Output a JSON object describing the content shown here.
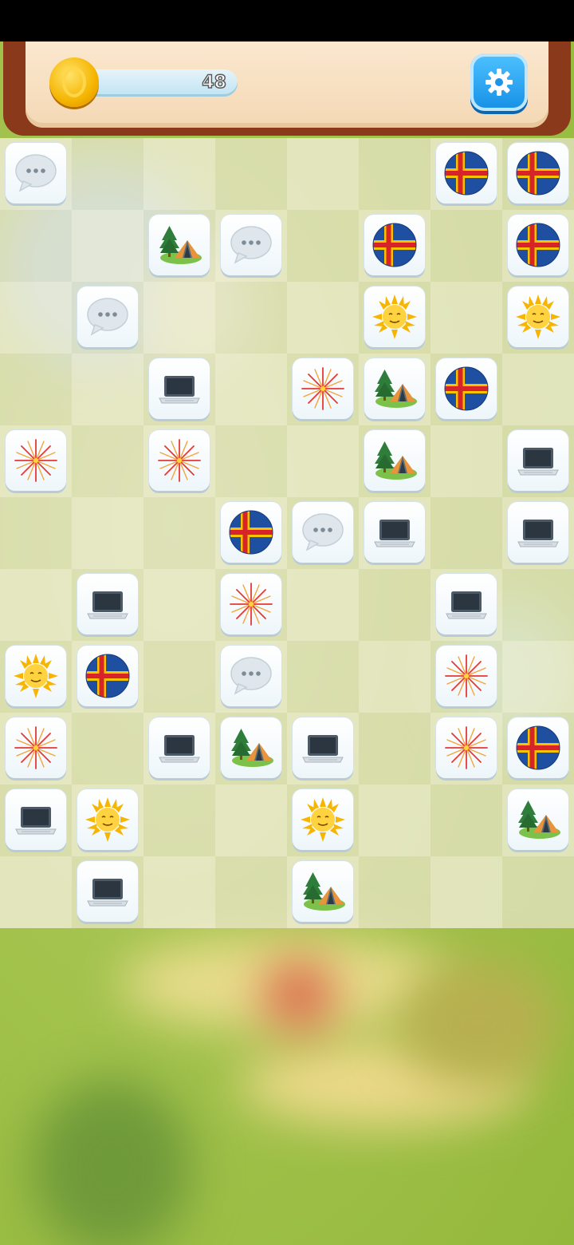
{
  "header": {
    "coins": "48",
    "coin_icon": "gold-coin-icon",
    "settings_icon": "gear-icon"
  },
  "tile_types": {
    "flag": "aland-flag-icon",
    "speech": "speech-bubble-icon",
    "camp": "camping-tent-icon",
    "sun": "sun-face-icon",
    "laptop": "laptop-icon",
    "fireworks": "fireworks-icon"
  },
  "board": {
    "columns": 8,
    "rows": 11,
    "tiles": [
      {
        "row": 0,
        "col": 0,
        "type": "speech"
      },
      {
        "row": 0,
        "col": 6,
        "type": "flag"
      },
      {
        "row": 0,
        "col": 7,
        "type": "flag"
      },
      {
        "row": 1,
        "col": 2,
        "type": "camp"
      },
      {
        "row": 1,
        "col": 3,
        "type": "speech"
      },
      {
        "row": 1,
        "col": 5,
        "type": "flag"
      },
      {
        "row": 1,
        "col": 7,
        "type": "flag"
      },
      {
        "row": 2,
        "col": 1,
        "type": "speech"
      },
      {
        "row": 2,
        "col": 5,
        "type": "sun"
      },
      {
        "row": 2,
        "col": 7,
        "type": "sun"
      },
      {
        "row": 3,
        "col": 2,
        "type": "laptop"
      },
      {
        "row": 3,
        "col": 4,
        "type": "fireworks"
      },
      {
        "row": 3,
        "col": 5,
        "type": "camp"
      },
      {
        "row": 3,
        "col": 6,
        "type": "flag"
      },
      {
        "row": 4,
        "col": 0,
        "type": "fireworks"
      },
      {
        "row": 4,
        "col": 2,
        "type": "fireworks"
      },
      {
        "row": 4,
        "col": 5,
        "type": "camp"
      },
      {
        "row": 4,
        "col": 7,
        "type": "laptop"
      },
      {
        "row": 5,
        "col": 3,
        "type": "flag"
      },
      {
        "row": 5,
        "col": 4,
        "type": "speech"
      },
      {
        "row": 5,
        "col": 5,
        "type": "laptop"
      },
      {
        "row": 5,
        "col": 7,
        "type": "laptop"
      },
      {
        "row": 6,
        "col": 1,
        "type": "laptop"
      },
      {
        "row": 6,
        "col": 3,
        "type": "fireworks"
      },
      {
        "row": 6,
        "col": 6,
        "type": "laptop"
      },
      {
        "row": 7,
        "col": 0,
        "type": "sun"
      },
      {
        "row": 7,
        "col": 1,
        "type": "flag"
      },
      {
        "row": 7,
        "col": 3,
        "type": "speech"
      },
      {
        "row": 7,
        "col": 6,
        "type": "fireworks"
      },
      {
        "row": 8,
        "col": 0,
        "type": "fireworks"
      },
      {
        "row": 8,
        "col": 2,
        "type": "laptop"
      },
      {
        "row": 8,
        "col": 3,
        "type": "camp"
      },
      {
        "row": 8,
        "col": 4,
        "type": "laptop"
      },
      {
        "row": 8,
        "col": 6,
        "type": "fireworks"
      },
      {
        "row": 8,
        "col": 7,
        "type": "flag"
      },
      {
        "row": 9,
        "col": 0,
        "type": "laptop"
      },
      {
        "row": 9,
        "col": 1,
        "type": "sun"
      },
      {
        "row": 9,
        "col": 4,
        "type": "sun"
      },
      {
        "row": 9,
        "col": 7,
        "type": "camp"
      },
      {
        "row": 10,
        "col": 1,
        "type": "laptop"
      },
      {
        "row": 10,
        "col": 4,
        "type": "camp"
      }
    ]
  }
}
